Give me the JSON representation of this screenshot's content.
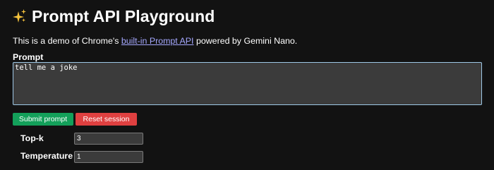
{
  "header": {
    "icon": "sparkles-icon",
    "title": "Prompt API Playground"
  },
  "intro": {
    "text_before": "This is a demo of Chrome's ",
    "link_text": "built-in Prompt API",
    "text_after": " powered by Gemini Nano."
  },
  "prompt": {
    "label": "Prompt",
    "value": "tell me a joke"
  },
  "buttons": {
    "submit_label": "Submit prompt",
    "reset_label": "Reset session"
  },
  "settings": {
    "topk_label": "Top-k",
    "topk_value": "3",
    "temperature_label": "Temperature",
    "temperature_value": "1"
  },
  "colors": {
    "background": "#121212",
    "link": "#a5a8ff",
    "submit_button": "#13a05a",
    "reset_button": "#df4040",
    "input_background": "#3b3b3b",
    "focus_border": "#9ec8e6"
  }
}
